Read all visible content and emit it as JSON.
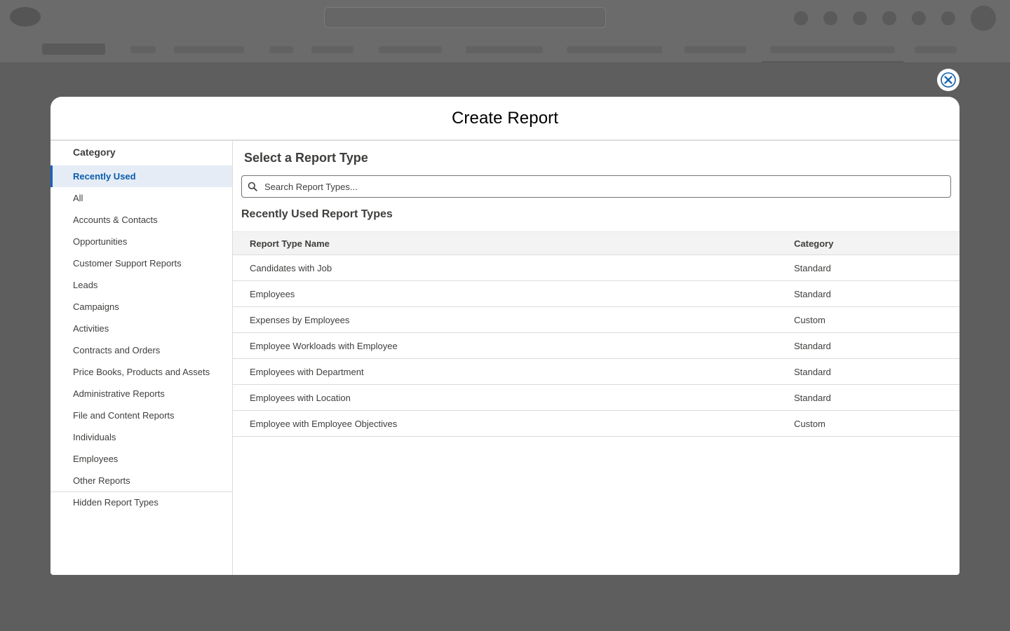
{
  "modal": {
    "title": "Create Report"
  },
  "sidebar": {
    "heading": "Category",
    "items": [
      {
        "label": "Recently Used",
        "active": true
      },
      {
        "label": "All"
      },
      {
        "label": "Accounts & Contacts"
      },
      {
        "label": "Opportunities"
      },
      {
        "label": "Customer Support Reports"
      },
      {
        "label": "Leads"
      },
      {
        "label": "Campaigns"
      },
      {
        "label": "Activities"
      },
      {
        "label": "Contracts and Orders"
      },
      {
        "label": "Price Books, Products and Assets"
      },
      {
        "label": "Administrative Reports"
      },
      {
        "label": "File and Content Reports"
      },
      {
        "label": "Individuals"
      },
      {
        "label": "Employees"
      },
      {
        "label": "Other Reports"
      }
    ],
    "hidden_item": "Hidden Report Types"
  },
  "main": {
    "heading": "Select a Report Type",
    "search_placeholder": "Search Report Types...",
    "section_heading": "Recently Used Report Types",
    "columns": {
      "name": "Report Type Name",
      "category": "Category"
    },
    "rows": [
      {
        "name": "Candidates with Job",
        "category": "Standard"
      },
      {
        "name": "Employees",
        "category": "Standard"
      },
      {
        "name": "Expenses by Employees",
        "category": "Custom"
      },
      {
        "name": "Employee Workloads with Employee",
        "category": "Standard"
      },
      {
        "name": "Employees with Department",
        "category": "Standard"
      },
      {
        "name": "Employees with Location",
        "category": "Standard"
      },
      {
        "name": "Employee with Employee Objectives",
        "category": "Custom"
      }
    ]
  },
  "icons": {
    "close": "close-icon",
    "search": "search-icon"
  },
  "colors": {
    "accent": "#0b5cab",
    "active_bg": "#e5ecf6",
    "overlay": "#5e5e5e"
  }
}
